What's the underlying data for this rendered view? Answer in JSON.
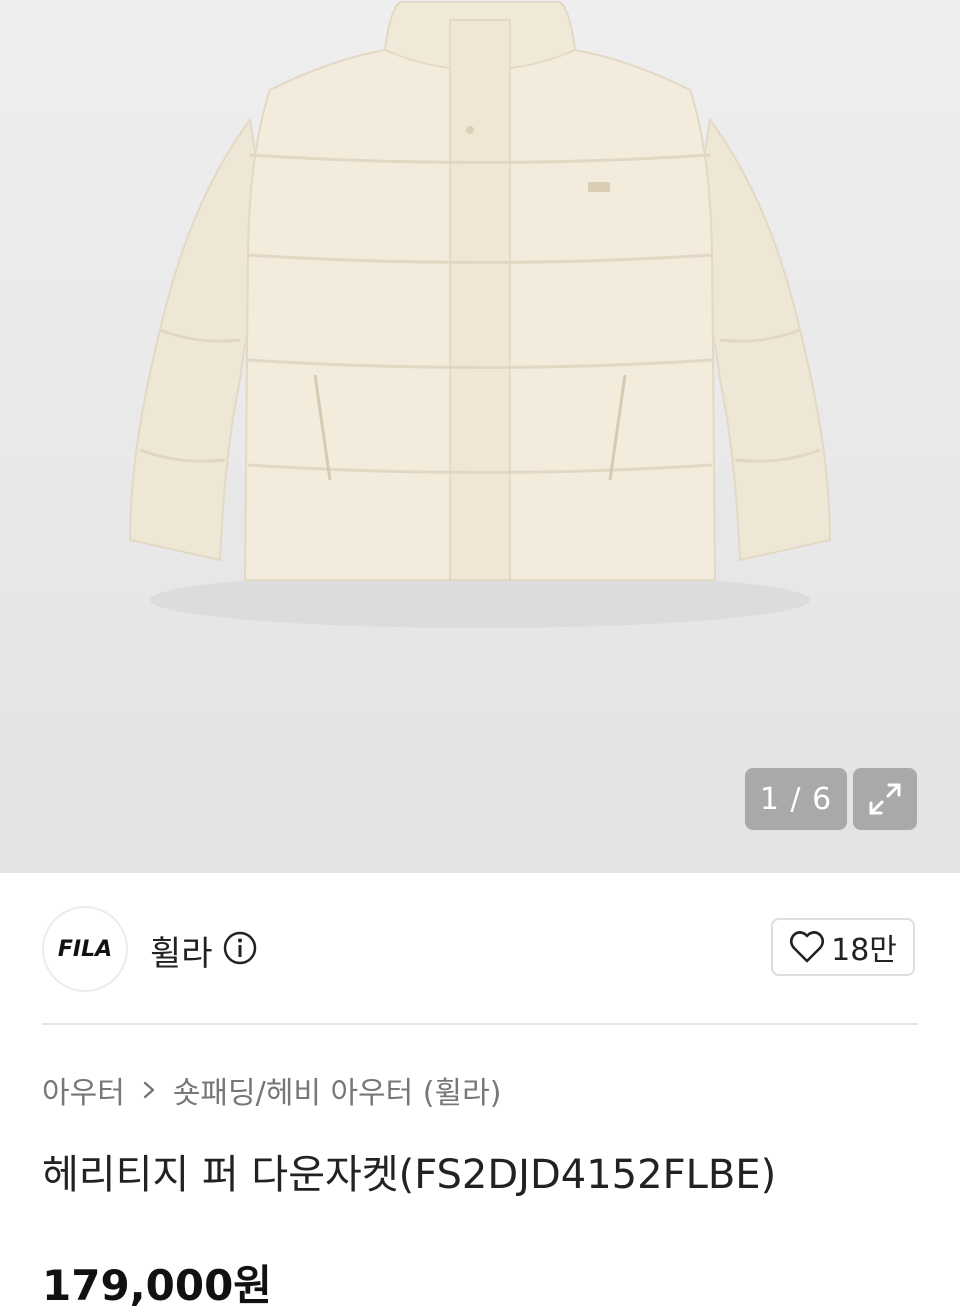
{
  "gallery": {
    "current": "1 / 6",
    "image_alt": "product-photo"
  },
  "brand": {
    "logo_text": "FILA",
    "name": "휠라"
  },
  "like": {
    "count": "18만"
  },
  "breadcrumb": {
    "level1": "아우터",
    "level2": "숏패딩/헤비 아우터 (휠라)"
  },
  "product": {
    "title": "헤리티지 퍼 다운자켓(FS2DJD4152FLBE)",
    "price": "179,000원"
  }
}
